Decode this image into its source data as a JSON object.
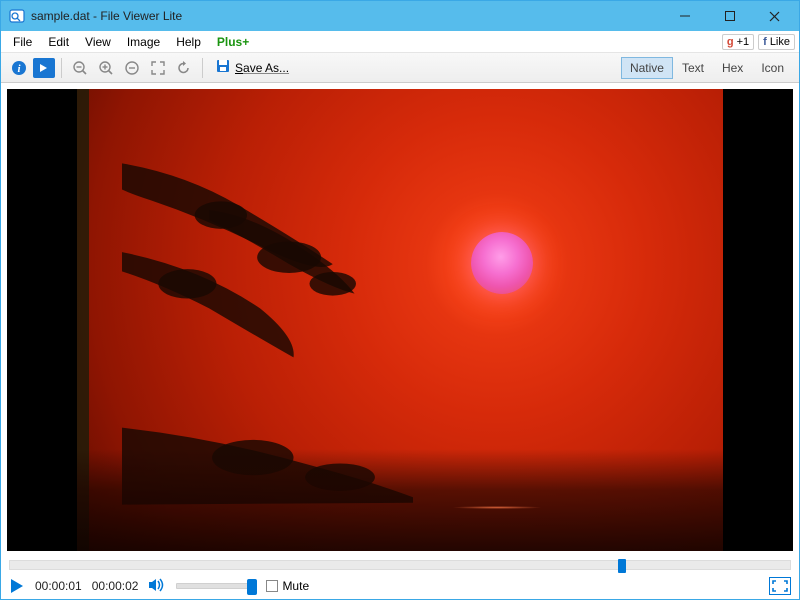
{
  "window": {
    "title": "sample.dat - File Viewer Lite"
  },
  "menu": {
    "items": [
      "File",
      "Edit",
      "View",
      "Image",
      "Help"
    ],
    "plus": "Plus+",
    "gplus_label": "+1",
    "fb_label": "Like"
  },
  "toolbar": {
    "save_as": "Save As...",
    "view_tabs": [
      "Native",
      "Text",
      "Hex",
      "Icon"
    ],
    "active_tab": "Native",
    "icons": {
      "info": "info-icon",
      "go": "arrow-right-icon",
      "zoom_out": "zoom-out-icon",
      "zoom_in": "zoom-in-icon",
      "fit": "fit-icon",
      "expand": "expand-icon",
      "rotate": "rotate-icon",
      "save": "save-icon"
    }
  },
  "playback": {
    "current_time": "00:00:01",
    "total_time": "00:00:02",
    "progress_pct": 78,
    "mute_label": "Mute",
    "muted": false,
    "volume_pct": 100
  }
}
